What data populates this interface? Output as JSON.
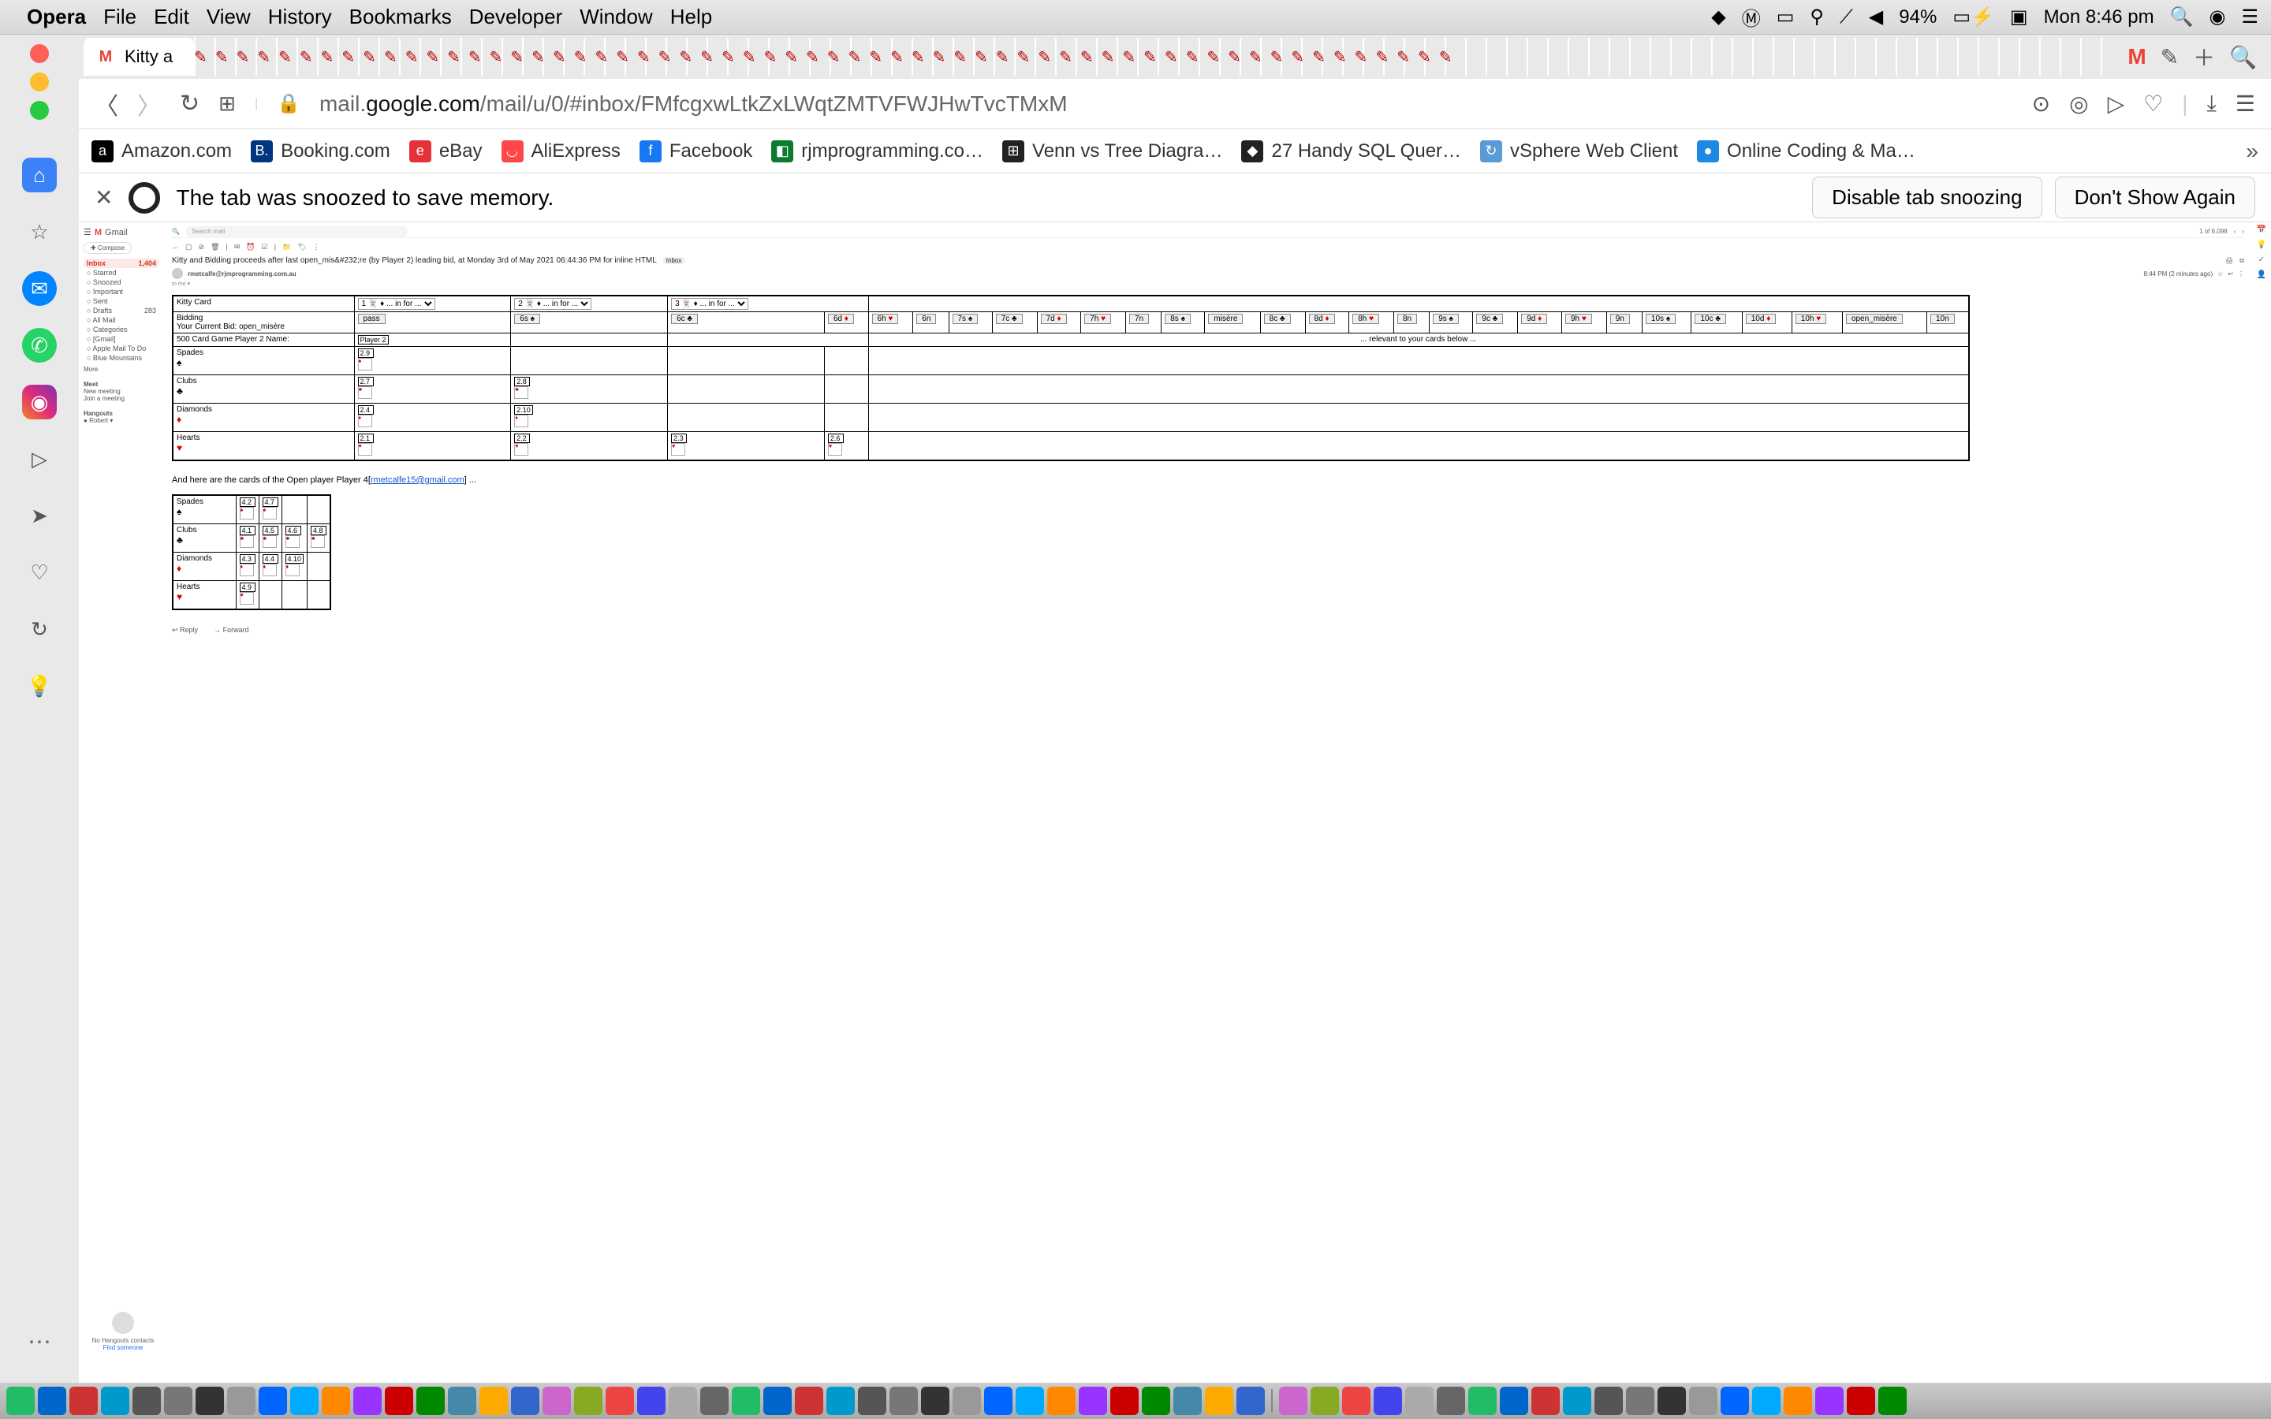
{
  "menubar": {
    "app": "Opera",
    "items": [
      "File",
      "Edit",
      "View",
      "History",
      "Bookmarks",
      "Developer",
      "Window",
      "Help"
    ],
    "battery": "94%",
    "date": "Mon 8:46 pm"
  },
  "tab": {
    "title": "Kitty a"
  },
  "addr": {
    "prefix": "mail.",
    "domain": "google.com",
    "path": "/mail/u/0/#inbox/FMfcgxwLtkZxLWqtZMTVFWJHwTvcTMxM"
  },
  "bookmarks": [
    {
      "label": "Amazon.com",
      "bg": "#000",
      "ltr": "a"
    },
    {
      "label": "Booking.com",
      "bg": "#003580",
      "ltr": "B."
    },
    {
      "label": "eBay",
      "bg": "#e53238",
      "ltr": "e"
    },
    {
      "label": "AliExpress",
      "bg": "#ff4747",
      "ltr": "◡"
    },
    {
      "label": "Facebook",
      "bg": "#1877f2",
      "ltr": "f"
    },
    {
      "label": "rjmprogramming.co…",
      "bg": "#0a7b2f",
      "ltr": "◧"
    },
    {
      "label": "Venn vs Tree Diagra…",
      "bg": "#222",
      "ltr": "⊞"
    },
    {
      "label": "27 Handy SQL Quer…",
      "bg": "#222",
      "ltr": "◆"
    },
    {
      "label": "vSphere Web Client",
      "bg": "#5b9bd5",
      "ltr": "↻"
    },
    {
      "label": "Online Coding & Ma…",
      "bg": "#1e88e5",
      "ltr": "●"
    }
  ],
  "snooze": {
    "msg": "The tab was snoozed to save memory.",
    "b1": "Disable tab snoozing",
    "b2": "Don't Show Again"
  },
  "gmail": {
    "brand": "Gmail",
    "search_ph": "Search mail",
    "compose": "Compose",
    "folders": [
      {
        "name": "Inbox",
        "count": "1,404",
        "active": true
      },
      {
        "name": "Starred"
      },
      {
        "name": "Snoozed"
      },
      {
        "name": "Important"
      },
      {
        "name": "Sent"
      },
      {
        "name": "Drafts",
        "count": "283"
      },
      {
        "name": "All Mail"
      },
      {
        "name": "Categories"
      },
      {
        "name": "[Gmail]"
      },
      {
        "name": "Apple Mail To Do"
      },
      {
        "name": "Blue Mountains"
      }
    ],
    "more": "More",
    "meet": "Meet",
    "meet_items": [
      "New meeting",
      "Join a meeting"
    ],
    "hangouts": "Hangouts",
    "hangouts_user": "Robert",
    "subject": "Kitty and Bidding proceeds after last open_mis&#232;re (by Player 2) leading bid, at Monday 3rd of May 2021 06:44:36 PM for inline HTML",
    "inbox_tag": "Inbox",
    "from": "rmetcalfe@rjmprogramming.com.au",
    "pager": "1 of 6,098",
    "timestamp": "8:44 PM (2 minutes ago)",
    "no_contacts": "No Hangouts contacts",
    "find_someone": "Find someone",
    "reply": "Reply",
    "forward": "Forward"
  },
  "game": {
    "kitty_label": "Kitty Card",
    "kitty_sel": [
      "1 🃏 ♦ ... in for ...",
      "2 🃏 ♦ ... in for ...",
      "3 🃏 ♦ ... in for ..."
    ],
    "bidding_label": "Bidding",
    "curbid_label": "Your Current Bid: open_misère",
    "bids": [
      "pass",
      "6s ♠",
      "6c ♣",
      "6d ♦",
      "6h ♥",
      "6n",
      "7s ♠",
      "7c ♣",
      "7d ♦",
      "7h ♥",
      "7n",
      "8s ♠",
      "misère",
      "8c ♣",
      "8d ♦",
      "8h ♥",
      "8n",
      "9s ♠",
      "9c ♣",
      "9d ♦",
      "9h ♥",
      "9n",
      "10s ♠",
      "10c ♣",
      "10d ♦",
      "10h ♥",
      "open_misère",
      "10n"
    ],
    "player_label": "500 Card Game Player 2 Name:",
    "player_val": "Player 2",
    "relevant": "... relevant to your cards below ...",
    "suits": [
      "Spades",
      "Clubs",
      "Diamonds",
      "Hearts"
    ],
    "p2": {
      "Spades": [
        "2.9"
      ],
      "Clubs": [
        "2.7",
        "2.8"
      ],
      "Diamonds": [
        "2.4",
        "2.10"
      ],
      "Hearts": [
        "2.1",
        "2.2",
        "2.3",
        "2.6"
      ]
    },
    "open_intro": "And here are the cards of the Open player Player 4[",
    "open_email": "rmetcalfe15@gmail.com",
    "open_suffix": "] ...",
    "p4": {
      "Spades": [
        "4.2",
        "4.7"
      ],
      "Clubs": [
        "4.1",
        "4.5",
        "4.6",
        "4.8"
      ],
      "Diamonds": [
        "4.3",
        "4.4",
        "4.10"
      ],
      "Hearts": [
        "4.9"
      ]
    }
  }
}
